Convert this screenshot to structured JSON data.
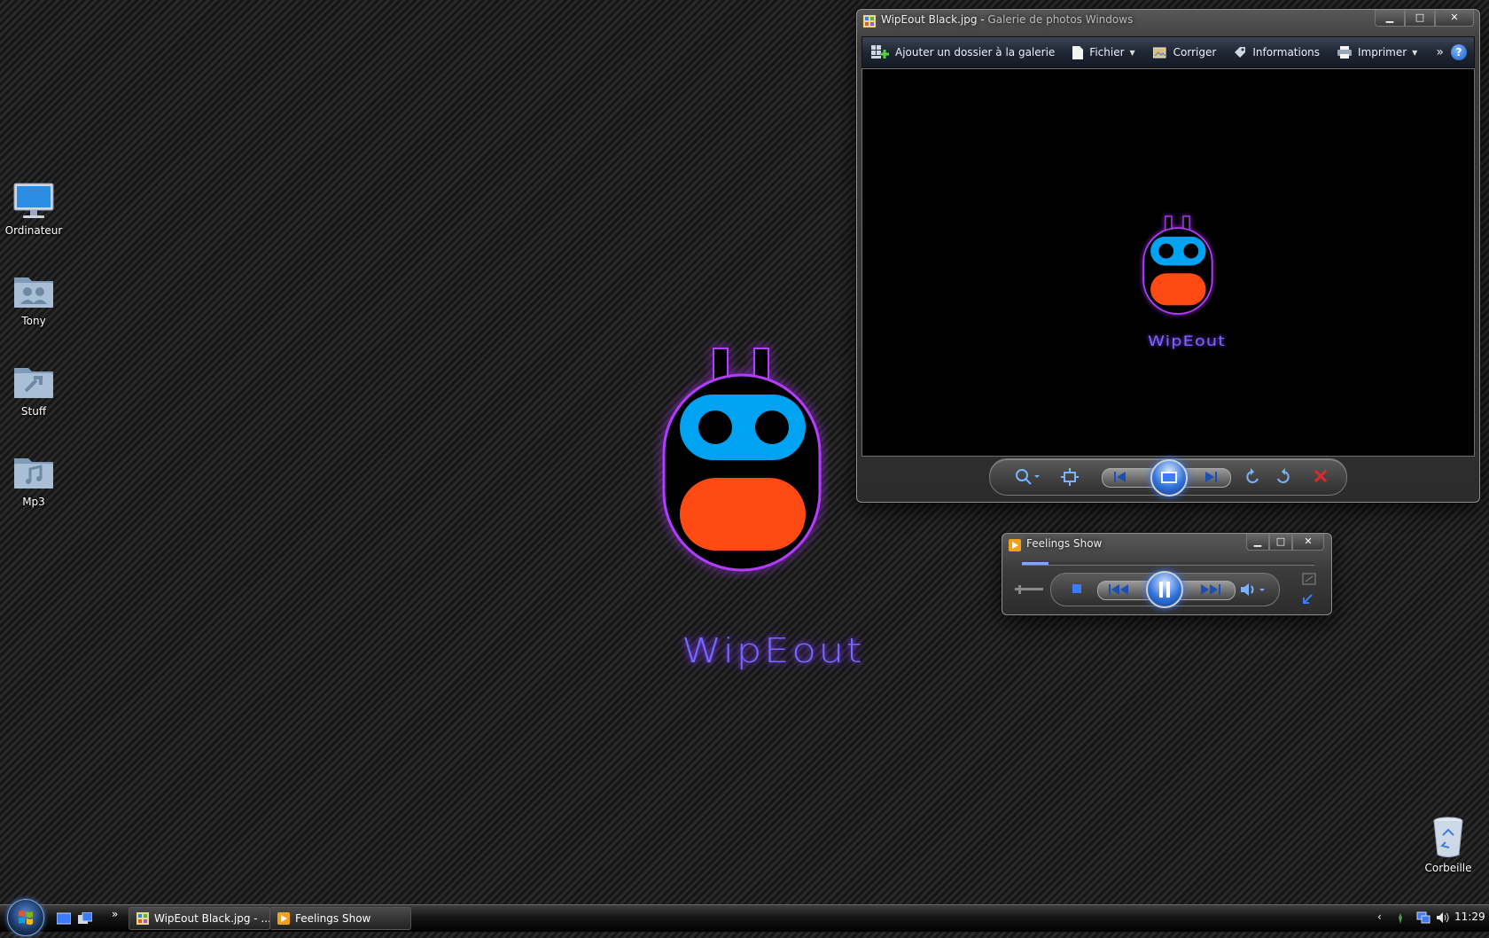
{
  "desktop": {
    "icons": [
      {
        "label": "Ordinateur",
        "icon": "computer-icon"
      },
      {
        "label": "Tony",
        "icon": "user-folder-icon"
      },
      {
        "label": "Stuff",
        "icon": "folder-icon"
      },
      {
        "label": "Mp3",
        "icon": "music-folder-icon"
      },
      {
        "label": "Corbeille",
        "icon": "recycle-bin-icon"
      }
    ],
    "wallpaper_word": "WipEout"
  },
  "gallery": {
    "title_main": "WipEout Black.jpg - ",
    "title_app": "Galerie de photos Windows",
    "window_buttons": [
      "minimize",
      "maximize",
      "close"
    ],
    "toolbar": {
      "add_folder": "Ajouter un dossier à la galerie",
      "file": "Fichier",
      "fix": "Corriger",
      "info": "Informations",
      "print": "Imprimer",
      "more": "»",
      "help": "?"
    },
    "image_word": "WipEout",
    "controls": [
      "zoom",
      "actual-size",
      "previous",
      "slideshow",
      "next",
      "rotate-left",
      "rotate-right",
      "delete"
    ]
  },
  "player": {
    "title": "Feelings Show",
    "progress": 0.09,
    "controls": [
      "stop",
      "previous",
      "play-pause",
      "next",
      "volume"
    ]
  },
  "taskbar": {
    "chevron": "»",
    "tasks": [
      {
        "label": "WipEout Black.jpg - ...",
        "icon": "photo-gallery-icon"
      },
      {
        "label": "Feelings Show",
        "icon": "media-player-icon"
      }
    ],
    "tray_arrow": "‹",
    "clock": "11:29"
  },
  "colors": {
    "logo_blue": "#00a2f2",
    "logo_orange": "#ff4a14",
    "logo_glow": "#b23cff",
    "accent": "#3b7cff"
  }
}
